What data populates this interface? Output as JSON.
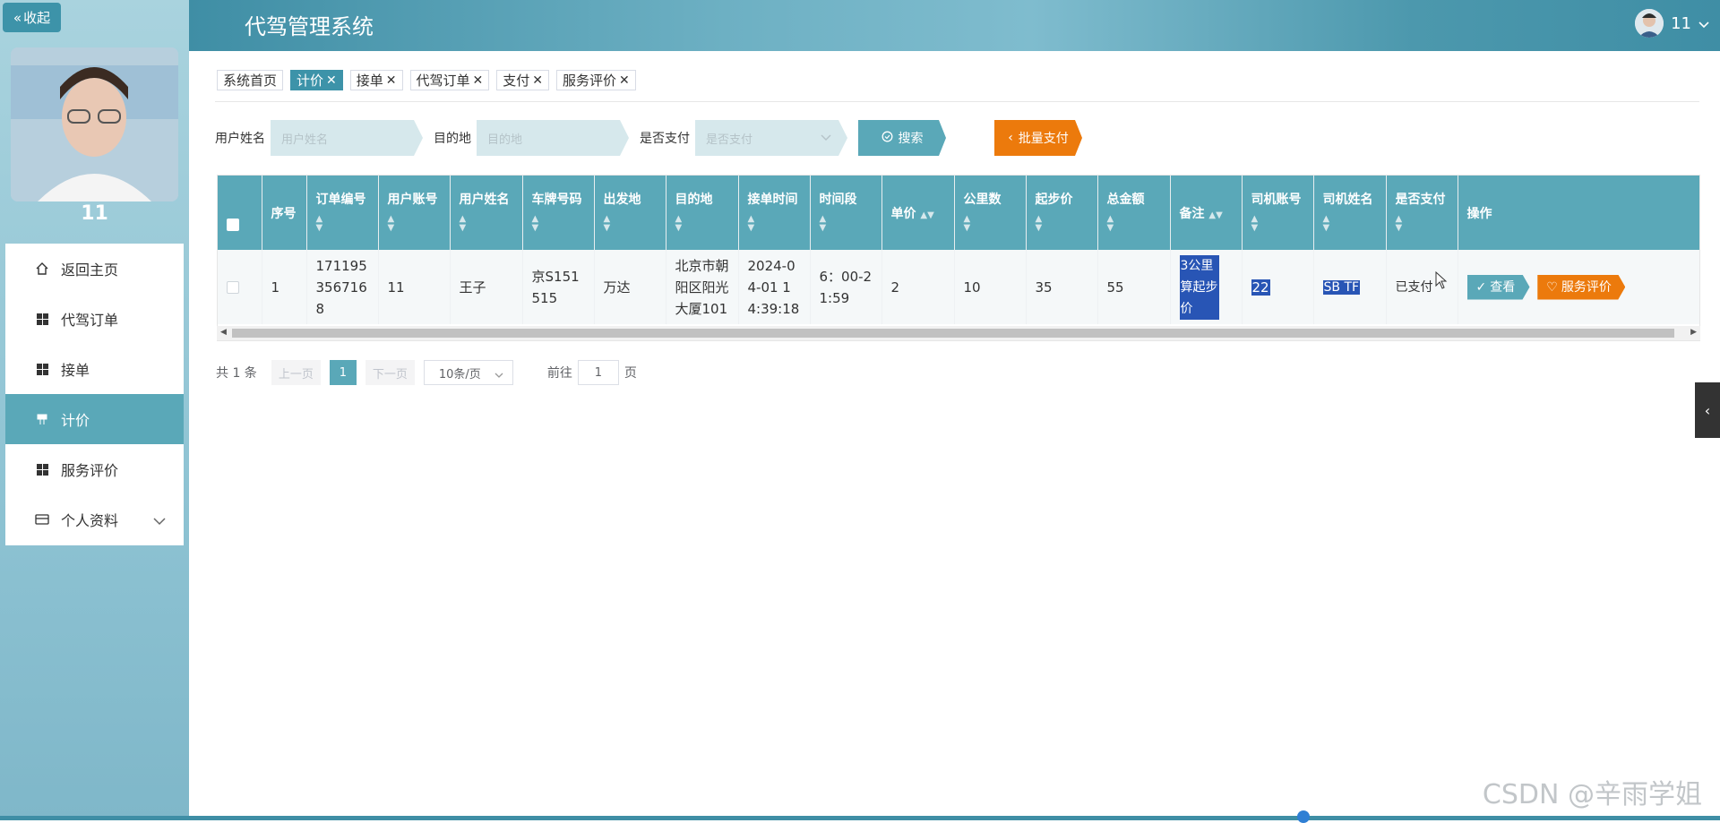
{
  "app": {
    "title": "代驾管理系统"
  },
  "user": {
    "name": "11"
  },
  "sidebar": {
    "collapse_label": "收起",
    "username": "11",
    "items": [
      {
        "label": "返回主页",
        "icon": "home-icon",
        "active": false
      },
      {
        "label": "代驾订单",
        "icon": "grid-icon",
        "active": false
      },
      {
        "label": "接单",
        "icon": "grid-icon",
        "active": false
      },
      {
        "label": "计价",
        "icon": "flag-icon",
        "active": true
      },
      {
        "label": "服务评价",
        "icon": "grid-icon",
        "active": false
      },
      {
        "label": "个人资料",
        "icon": "wallet-icon",
        "active": false
      }
    ]
  },
  "tabs": [
    {
      "label": "系统首页",
      "closable": false,
      "active": false
    },
    {
      "label": "计价",
      "closable": true,
      "active": true
    },
    {
      "label": "接单",
      "closable": true,
      "active": false
    },
    {
      "label": "代驾订单",
      "closable": true,
      "active": false
    },
    {
      "label": "支付",
      "closable": true,
      "active": false
    },
    {
      "label": "服务评价",
      "closable": true,
      "active": false
    }
  ],
  "search": {
    "name_label": "用户姓名",
    "name_placeholder": "用户姓名",
    "dest_label": "目的地",
    "dest_placeholder": "目的地",
    "paid_label": "是否支付",
    "paid_placeholder": "是否支付",
    "search_btn": "搜索",
    "batch_btn": "批量支付"
  },
  "table": {
    "columns": [
      "序号",
      "订单编号",
      "用户账号",
      "用户姓名",
      "车牌号码",
      "出发地",
      "目的地",
      "接单时间",
      "时间段",
      "单价",
      "公里数",
      "起步价",
      "总金额",
      "备注",
      "司机账号",
      "司机姓名",
      "是否支付",
      "操作"
    ],
    "rows": [
      {
        "index": "1",
        "order_no": "1711953567168",
        "user_account": "11",
        "user_name": "王子",
        "plate": "京S151515",
        "origin": "万达",
        "destination": "北京市朝阳区阳光大厦101",
        "accept_time": "2024-04-01 14:39:18",
        "period": "6：00-21:59",
        "unit_price": "2",
        "km": "10",
        "base_price": "35",
        "total": "55",
        "note": "3公里算起步价",
        "driver_account": "22",
        "driver_name": "SB TF",
        "paid": "已支付",
        "view_btn": "查看",
        "review_btn": "服务评价"
      }
    ]
  },
  "pagination": {
    "total_text": "共 1 条",
    "prev": "上一页",
    "current": "1",
    "next": "下一页",
    "page_size": "10条/页",
    "goto_label": "前往",
    "goto_value": "1",
    "page_suffix": "页"
  },
  "watermark": "CSDN @辛雨学姐",
  "colors": {
    "primary": "#5aa8b8",
    "accent": "#3d93a9",
    "orange": "#ec7a0c",
    "highlight": "#2855b5"
  }
}
